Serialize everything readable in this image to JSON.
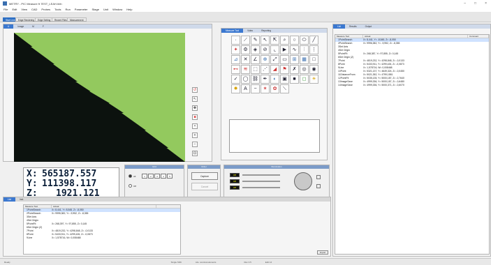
{
  "window": {
    "title": "METRY - PIC Measure ft 7EST_LEAH.hbh"
  },
  "menu": [
    "File",
    "Edit",
    "View",
    "CAD",
    "Probes",
    "Tools",
    "Run",
    "Parameter",
    "Stage",
    "Unit",
    "Window",
    "Help"
  ],
  "doc_tabs": [
    "Start Link",
    "Edge Rendering",
    "Edge Setting",
    "Recent Files",
    "Measurement"
  ],
  "image_tabs": [
    "U",
    "Image",
    "M",
    "F"
  ],
  "palette_tabs": [
    "Measure Tool",
    "Video",
    "Reporting"
  ],
  "right_tabs": [
    "List",
    "Results",
    "Output"
  ],
  "bottom_tabs": [
    "List",
    "Inst."
  ],
  "coords": {
    "x": "565187.557",
    "y": "111398.117",
    "z": "1921.121",
    "xl": "X:",
    "yl": "Y:",
    "zl": "Z:"
  },
  "panels": {
    "grid_hdr": "Grid",
    "cap_hdr": "Order",
    "illum_hdr": "Illumination"
  },
  "grid": {
    "opt1": "All",
    "opt2": "Off",
    "cells": [
      "1",
      "2",
      "3",
      "4",
      "5"
    ]
  },
  "capture": {
    "capture": "Capture",
    "cancel": "Cancel"
  },
  "sliders": [
    "Off",
    "Off",
    "Off"
  ],
  "list": {
    "col_measure": "Measure Tool",
    "col_actual": "Actual",
    "col_comment": "Comment",
    "rows": [
      {
        "n": "1PointSearch",
        "a": "X= 8,441, Y= -8,545, Z= -8,050"
      },
      {
        "n": "2PointSearch",
        "a": "X= 9996,382, Y= -9,952, Z= -8,355"
      },
      {
        "n": "3Set Axis",
        "a": ""
      },
      {
        "n": "4Set Origin",
        "a": ""
      },
      {
        "n": "5PointFit",
        "a": "X= 268,387, Y= 97,855, Z= 0,145"
      },
      {
        "n": "6Set Origin (Z)",
        "a": ""
      },
      {
        "n": "7Point",
        "a": "X= 4819,232, Y= 4298,848, Z= -0,0133"
      },
      {
        "n": "8Point",
        "a": "X= 5433,911, Y= 4299,426, Z= -0,0873"
      },
      {
        "n": "9Line",
        "a": "X= 1,578716, W= 0,008468"
      },
      {
        "n": "10Point",
        "a": "X= 5321,137, Y= 4649,324, Z= -0,0450"
      },
      {
        "n": "11DistanceFrom",
        "a": "X= 5021,352, Y= 4799,1581"
      },
      {
        "n": "12PointFit",
        "a": "X= 5035,135, Y= 5000,187, Z= -0,7640"
      },
      {
        "n": "13ImageSave",
        "a": "X= 4999,336, Y= 5000,187, Z= -0,6480"
      },
      {
        "n": "14ImageSave",
        "a": "X= 4999,336, Y= 5000,371, Z= -0,6070"
      }
    ]
  },
  "bottom_list": {
    "col_measure": "Measure Tool",
    "col_actual": "Actual",
    "rows": [
      {
        "n": "1PointSearch",
        "a": "X= 8,441, Y= 8,545, Z= -8,050"
      },
      {
        "n": "2PointSearch",
        "a": "X= 9995,382, Y= -9,952, Z= -8,355"
      },
      {
        "n": "3Set Axis",
        "a": ""
      },
      {
        "n": "4Set Origin",
        "a": ""
      },
      {
        "n": "5PointFit",
        "a": "X= 268,397, Y= 97,855, Z= 0,145"
      },
      {
        "n": "6Set Origin (Z)",
        "a": ""
      },
      {
        "n": "7Point",
        "a": "X= 4819,232, Y= 4298,848, Z= -0,0133"
      },
      {
        "n": "8Point",
        "a": "X= 5433,911, Y= 4299,426, Z= -0,0873"
      },
      {
        "n": "9Line",
        "a": "X= 1,578716, W= 0,008468"
      }
    ]
  },
  "import_btn": "Import",
  "status": [
    "Ready",
    "Single Shift",
    "ALL nominal elements",
    "Rev 3.5",
    "Edit 14"
  ]
}
